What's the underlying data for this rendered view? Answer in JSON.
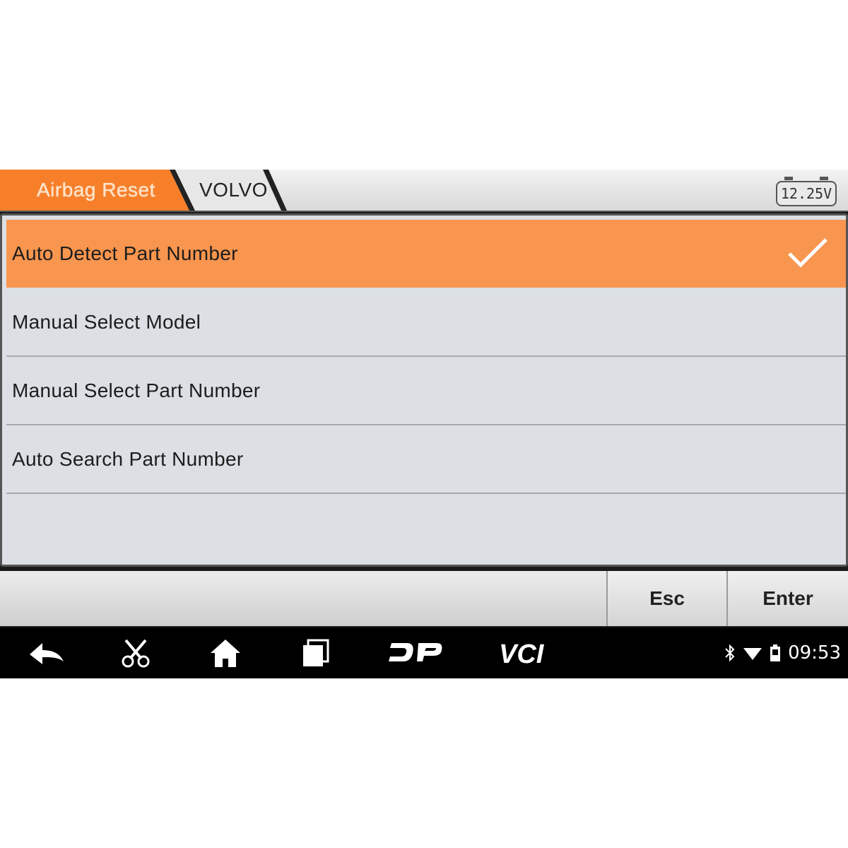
{
  "breadcrumb": {
    "items": [
      "Airbag Reset",
      "VOLVO"
    ]
  },
  "battery": {
    "voltage": "12.25V"
  },
  "menu": {
    "items": [
      {
        "label": "Auto Detect Part Number",
        "selected": true
      },
      {
        "label": "Manual Select Model",
        "selected": false
      },
      {
        "label": "Manual Select Part Number",
        "selected": false
      },
      {
        "label": "Auto Search Part Number",
        "selected": false
      }
    ]
  },
  "buttons": {
    "esc": "Esc",
    "enter": "Enter"
  },
  "navbar": {
    "icons": [
      "back-icon",
      "scissors-icon",
      "home-icon",
      "recent-apps-icon",
      "dp-icon",
      "vci-icon"
    ],
    "dp_label": "DP",
    "vci_label": "VCI"
  },
  "status": {
    "time": "09:53"
  },
  "colors": {
    "accent": "#f8954e",
    "crumb_active": "#f77f2a",
    "panel_bg": "#dcdfe4"
  }
}
